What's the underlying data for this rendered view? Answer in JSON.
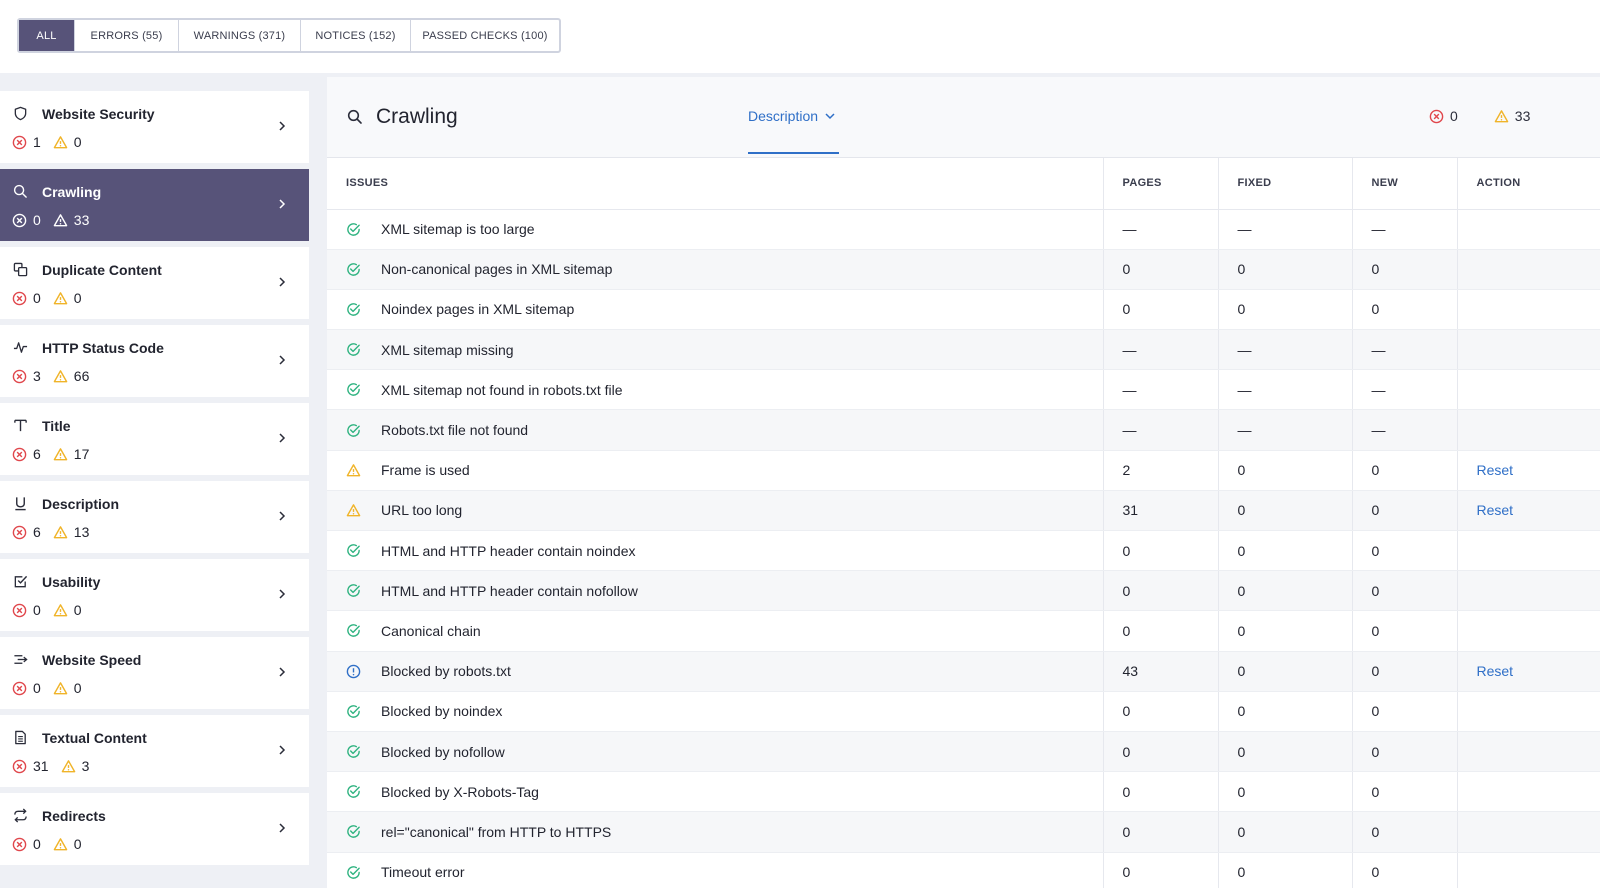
{
  "filters": [
    {
      "label": "ALL",
      "active": true
    },
    {
      "label": "ERRORS (55)"
    },
    {
      "label": "WARNINGS (371)"
    },
    {
      "label": "NOTICES (152)"
    },
    {
      "label": "PASSED CHECKS (100)"
    }
  ],
  "sidebar": {
    "items": [
      {
        "label": "Website Security",
        "icon": "shield-icon",
        "errors": "1",
        "warnings": "0"
      },
      {
        "label": "Crawling",
        "icon": "search-icon",
        "errors": "0",
        "warnings": "33",
        "active": true
      },
      {
        "label": "Duplicate Content",
        "icon": "duplicate-icon",
        "errors": "0",
        "warnings": "0"
      },
      {
        "label": "HTTP Status Code",
        "icon": "pulse-icon",
        "errors": "3",
        "warnings": "66"
      },
      {
        "label": "Title",
        "icon": "title-icon",
        "errors": "6",
        "warnings": "17"
      },
      {
        "label": "Description",
        "icon": "underline-icon",
        "errors": "6",
        "warnings": "13"
      },
      {
        "label": "Usability",
        "icon": "checkbox-icon",
        "errors": "0",
        "warnings": "0"
      },
      {
        "label": "Website Speed",
        "icon": "speed-icon",
        "errors": "0",
        "warnings": "0"
      },
      {
        "label": "Textual Content",
        "icon": "document-icon",
        "errors": "31",
        "warnings": "3"
      },
      {
        "label": "Redirects",
        "icon": "redirect-icon",
        "errors": "0",
        "warnings": "0"
      }
    ]
  },
  "main": {
    "title": "Crawling",
    "description_label": "Description",
    "errors": "0",
    "warnings": "33",
    "columns": [
      "ISSUES",
      "PAGES",
      "FIXED",
      "NEW",
      "ACTION"
    ],
    "rows": [
      {
        "status": "passed",
        "issue": "XML sitemap is too large",
        "pages": "—",
        "fixed": "—",
        "new": "—",
        "action": ""
      },
      {
        "status": "passed",
        "issue": "Non-canonical pages in XML sitemap",
        "pages": "0",
        "fixed": "0",
        "new": "0",
        "action": ""
      },
      {
        "status": "passed",
        "issue": "Noindex pages in XML sitemap",
        "pages": "0",
        "fixed": "0",
        "new": "0",
        "action": ""
      },
      {
        "status": "passed",
        "issue": "XML sitemap missing",
        "pages": "—",
        "fixed": "—",
        "new": "—",
        "action": ""
      },
      {
        "status": "passed",
        "issue": "XML sitemap not found in robots.txt file",
        "pages": "—",
        "fixed": "—",
        "new": "—",
        "action": ""
      },
      {
        "status": "passed",
        "issue": "Robots.txt file not found",
        "pages": "—",
        "fixed": "—",
        "new": "—",
        "action": ""
      },
      {
        "status": "warning",
        "issue": "Frame is used",
        "pages": "2",
        "fixed": "0",
        "new": "0",
        "action": "Reset"
      },
      {
        "status": "warning",
        "issue": "URL too long",
        "pages": "31",
        "fixed": "0",
        "new": "0",
        "action": "Reset"
      },
      {
        "status": "passed",
        "issue": "HTML and HTTP header contain noindex",
        "pages": "0",
        "fixed": "0",
        "new": "0",
        "action": ""
      },
      {
        "status": "passed",
        "issue": "HTML and HTTP header contain nofollow",
        "pages": "0",
        "fixed": "0",
        "new": "0",
        "action": ""
      },
      {
        "status": "passed",
        "issue": "Canonical chain",
        "pages": "0",
        "fixed": "0",
        "new": "0",
        "action": ""
      },
      {
        "status": "notice",
        "issue": "Blocked by robots.txt",
        "pages": "43",
        "fixed": "0",
        "new": "0",
        "action": "Reset"
      },
      {
        "status": "passed",
        "issue": "Blocked by noindex",
        "pages": "0",
        "fixed": "0",
        "new": "0",
        "action": ""
      },
      {
        "status": "passed",
        "issue": "Blocked by nofollow",
        "pages": "0",
        "fixed": "0",
        "new": "0",
        "action": ""
      },
      {
        "status": "passed",
        "issue": "Blocked by X-Robots-Tag",
        "pages": "0",
        "fixed": "0",
        "new": "0",
        "action": ""
      },
      {
        "status": "passed",
        "issue": "rel=\"canonical\" from HTTP to HTTPS",
        "pages": "0",
        "fixed": "0",
        "new": "0",
        "action": ""
      },
      {
        "status": "passed",
        "issue": "Timeout error",
        "pages": "0",
        "fixed": "0",
        "new": "0",
        "action": ""
      }
    ]
  },
  "colors": {
    "accent": "#575379",
    "link": "#2f6fc7",
    "error": "#e0474c",
    "warning": "#f0b429",
    "passed": "#2fb380",
    "notice": "#2f6fc7"
  }
}
